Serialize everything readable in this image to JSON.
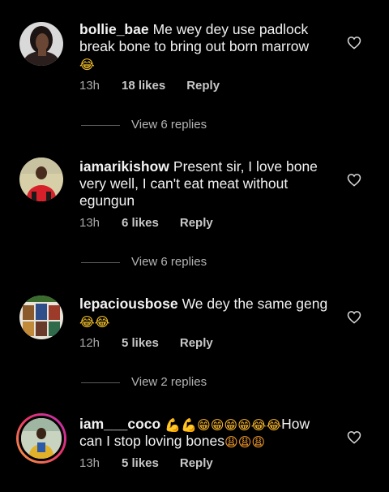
{
  "comments": [
    {
      "username": "bollie_bae",
      "text": "Me wey dey use padlock break bone to bring out born marrow",
      "emoji": "😂",
      "time": "13h",
      "likes": "18 likes",
      "reply_label": "Reply",
      "view_replies": "View 6 replies"
    },
    {
      "username": "iamarikishow",
      "text": "Present sir, I love bone very well, I can't eat meat without egungun",
      "time": "13h",
      "likes": "6 likes",
      "reply_label": "Reply",
      "view_replies": "View 6 replies"
    },
    {
      "username": "lepaciousbose",
      "text": "We dey the same geng",
      "emoji": "😂😂",
      "time": "12h",
      "likes": "5 likes",
      "reply_label": "Reply",
      "view_replies": "View 2 replies"
    },
    {
      "username": "iam___coco",
      "emoji_lead": "💪💪😁😁😁😁😂😂",
      "text": "How can I stop loving bones",
      "emoji_trail": "😩😩😩",
      "time": "13h",
      "likes": "5 likes",
      "reply_label": "Reply"
    }
  ],
  "icons": {
    "like": "heart-outline-icon"
  },
  "colors": {
    "background": "#000000",
    "text": "#f2f2f2",
    "meta": "#a8a8a8",
    "story_ring": [
      "#f9a23b",
      "#e9336b",
      "#b62fb9"
    ]
  }
}
